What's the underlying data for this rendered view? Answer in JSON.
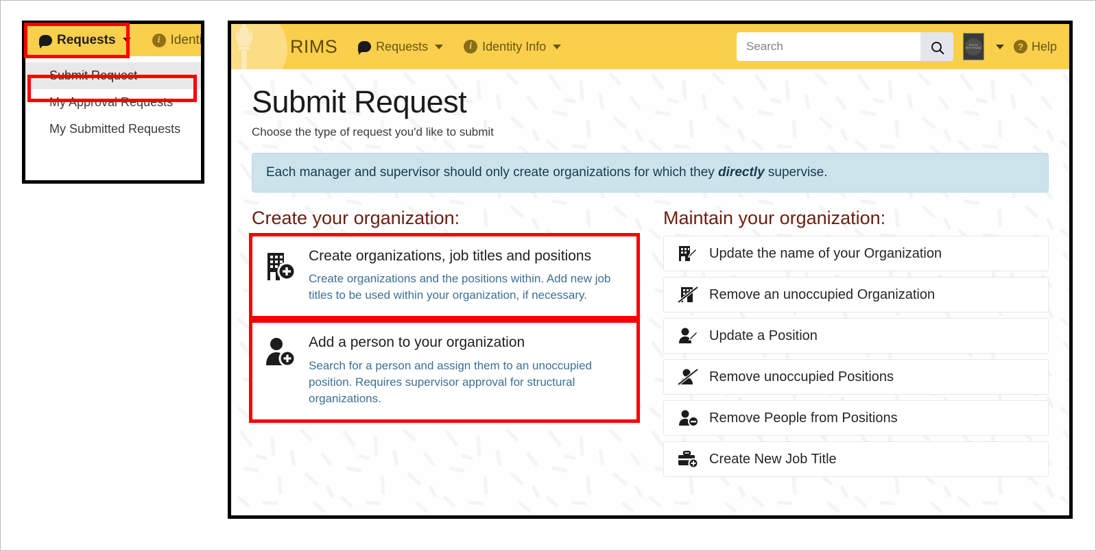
{
  "colors": {
    "navbar_yellow": "#f9cf4c",
    "highlight_red": "#fa0000",
    "heading_maroon": "#6b2012",
    "link_blue": "#3c6f97",
    "alert_bg": "#cde3ec",
    "frame_black": "#000000"
  },
  "dropdown_panel": {
    "navbar": {
      "requests": {
        "label": "Requests",
        "icon": "chat-bubble-icon",
        "caret": "chevron-down-icon"
      },
      "identity": {
        "label": "Identity In",
        "icon": "info-circle-icon"
      }
    },
    "menu_items": [
      {
        "label": "Submit Request",
        "active": true
      },
      {
        "label": "My Approval Requests",
        "active": false
      },
      {
        "label": "My Submitted Requests",
        "active": false
      }
    ]
  },
  "app": {
    "navbar": {
      "brand": "RIMS",
      "links": [
        {
          "label": "Requests",
          "icon": "chat-bubble-icon"
        },
        {
          "label": "Identity Info",
          "icon": "info-circle-icon"
        }
      ],
      "search": {
        "placeholder": "Search",
        "value": "",
        "button_icon": "search-icon"
      },
      "avatar": {
        "alt_line1": "PHOTO",
        "alt_line2": "NOT FOUND"
      },
      "help": {
        "label": "Help",
        "icon": "question-circle-icon"
      }
    },
    "page": {
      "title": "Submit Request",
      "subtitle": "Choose the type of request you'd like to submit",
      "alert": {
        "prefix": "Each manager and supervisor should only create organizations for which they ",
        "emphasis": "directly",
        "suffix": " supervise."
      }
    },
    "left_column": {
      "heading": "Create your organization:",
      "cards": [
        {
          "icon": "building-plus-icon",
          "title": "Create organizations, job titles and positions",
          "description": "Create organizations and the positions within. Add new job titles to be used within your organization, if necessary.",
          "highlighted": true
        },
        {
          "icon": "person-plus-icon",
          "title": "Add a person to your organization",
          "description": "Search for a person and assign them to an unoccupied position. Requires supervisor approval for structural organizations.",
          "highlighted": true
        }
      ]
    },
    "right_column": {
      "heading": "Maintain your organization:",
      "items": [
        {
          "icon": "building-pencil-icon",
          "label": "Update the name of your Organization"
        },
        {
          "icon": "building-slash-icon",
          "label": "Remove an unoccupied Organization"
        },
        {
          "icon": "person-pencil-icon",
          "label": "Update a Position"
        },
        {
          "icon": "person-slash-icon",
          "label": "Remove unoccupied Positions"
        },
        {
          "icon": "person-minus-icon",
          "label": "Remove People from Positions"
        },
        {
          "icon": "briefcase-plus-icon",
          "label": "Create New Job Title"
        }
      ]
    }
  }
}
